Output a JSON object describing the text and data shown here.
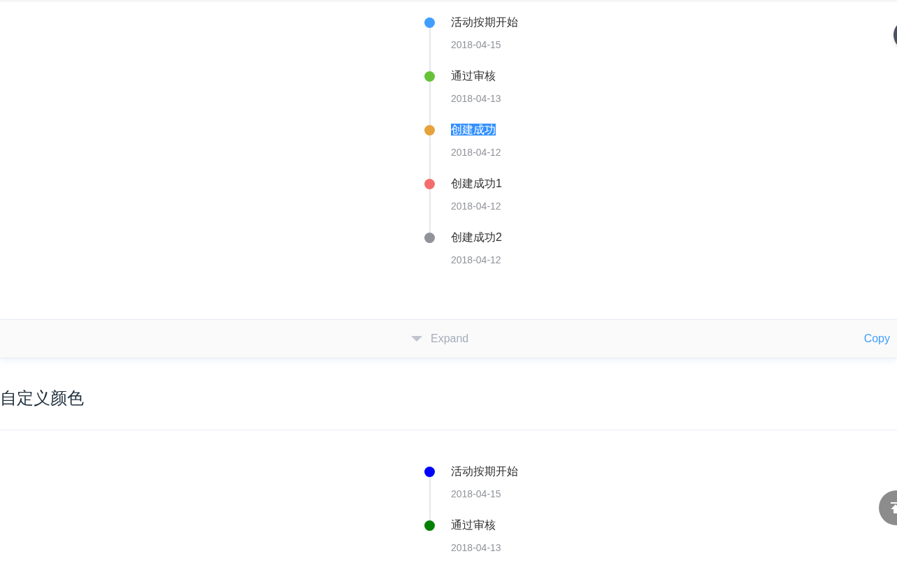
{
  "timelines": [
    {
      "items": [
        {
          "title": "活动按期开始",
          "date": "2018-04-15",
          "color": "#409eff",
          "highlighted": false
        },
        {
          "title": "通过审核",
          "date": "2018-04-13",
          "color": "#67c23a",
          "highlighted": false
        },
        {
          "title": "创建成功",
          "date": "2018-04-12",
          "color": "#e6a23c",
          "highlighted": true
        },
        {
          "title": "创建成功1",
          "date": "2018-04-12",
          "color": "#f56c6c",
          "highlighted": false
        },
        {
          "title": "创建成功2",
          "date": "2018-04-12",
          "color": "#909399",
          "highlighted": false
        }
      ]
    },
    {
      "items": [
        {
          "title": "活动按期开始",
          "date": "2018-04-15",
          "color": "#0000ff",
          "highlighted": false
        },
        {
          "title": "通过审核",
          "date": "2018-04-13",
          "color": "#008000",
          "highlighted": false
        }
      ]
    }
  ],
  "code_bar": {
    "expand": "Expand",
    "copy": "Copy"
  },
  "section_heading": "自定义颜色"
}
